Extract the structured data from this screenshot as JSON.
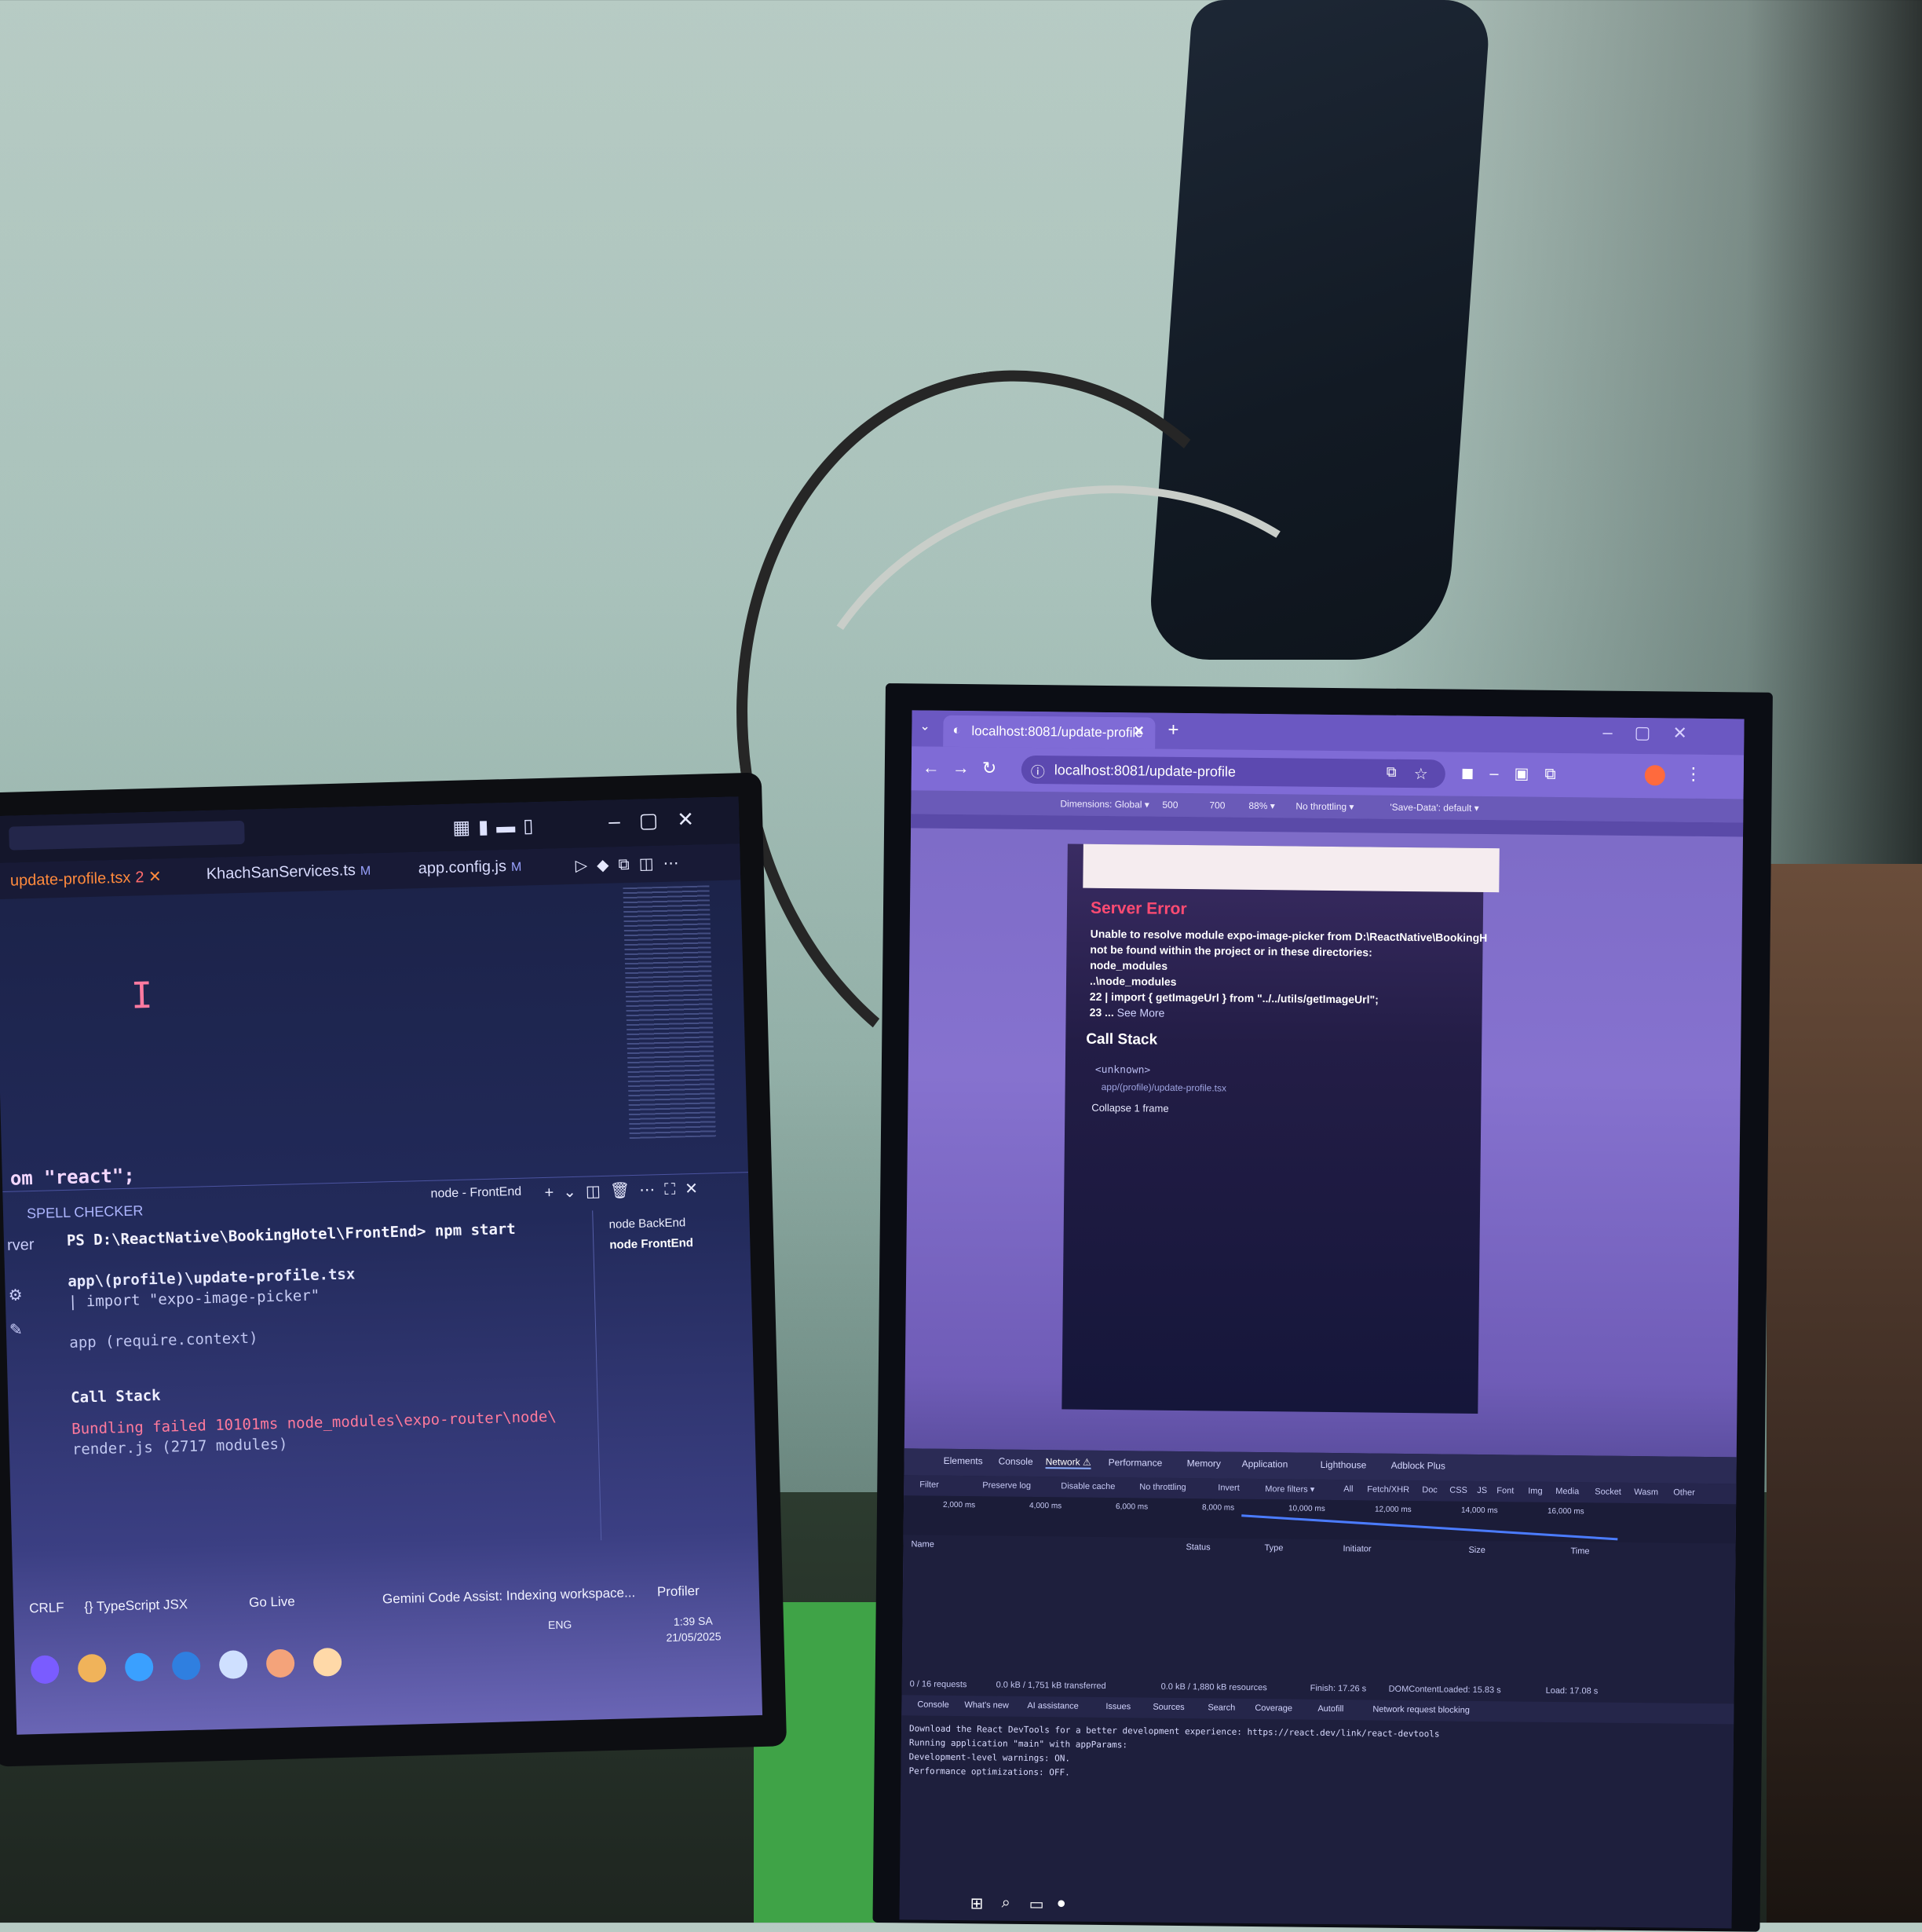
{
  "colors": {
    "vscode_tab_active": "#ff8a3d",
    "error_red": "#ff4b72",
    "chrome_frame": "#7f6bd6"
  },
  "laptop": {
    "tabs": [
      {
        "label": "update-profile.tsx",
        "badge": "2"
      },
      {
        "label": "KhachSanServices.ts",
        "badge": "M"
      },
      {
        "label": "app.config.js",
        "badge": "M"
      }
    ],
    "editor_code": "om \"react\";",
    "panel_label": "SPELL CHECKER",
    "terminal_tab": "node - FrontEnd",
    "sessions": [
      "node BackEnd",
      "node FrontEnd"
    ],
    "terminal": {
      "prompt": "PS D:\\ReactNative\\BookingHotel\\FrontEnd> npm start",
      "path": "app\\(profile)\\update-profile.tsx",
      "import_line": "| import \"expo-image-picker\"",
      "app_line": "app (require.context)",
      "call_stack": "Call Stack",
      "bundling": "Bundling failed 10101ms node_modules\\expo-router\\node\\",
      "render": "render.js (2717 modules)"
    },
    "gutter_label": "rver",
    "status": {
      "crlf": "CRLF",
      "lang": "{} TypeScript JSX",
      "golive": "Go Live",
      "gemini": "Gemini Code Assist: Indexing workspace...",
      "profiler": "Profiler"
    },
    "tray": {
      "lang": "ENG",
      "time": "1:39 SA",
      "date": "21/05/2025"
    }
  },
  "browser": {
    "tab_title": "localhost:8081/update-profile",
    "url": "localhost:8081/update-profile",
    "device_toolbar": {
      "dimensions": "Dimensions: Global ▾",
      "width": "500",
      "height": "700",
      "zoom": "88% ▾",
      "throttle": "No throttling ▾",
      "save_data": "'Save-Data': default ▾"
    },
    "error": {
      "title": "Server Error",
      "lines": [
        "Unable to resolve module expo-image-picker from D:\\ReactNative\\BookingH",
        "not be found within the project or in these directories:",
        "node_modules",
        "..\\node_modules",
        "22 | import { getImageUrl } from \"../../utils/getImageUrl\";",
        "23 ..."
      ],
      "see_more": "See More",
      "call_stack_title": "Call Stack",
      "frame_fn": "<unknown>",
      "frame_file": "app/(profile)/update-profile.tsx",
      "collapse": "Collapse 1 frame"
    },
    "devtools": {
      "tabs": [
        "Elements",
        "Console",
        "Network ⚠",
        "Performance",
        "Memory",
        "Application",
        "Lighthouse",
        "Adblock Plus"
      ],
      "toolbar": [
        "Filter",
        "Preserve log",
        "Disable cache",
        "No throttling",
        "Invert",
        "More filters ▾",
        "All",
        "Fetch/XHR",
        "Doc",
        "CSS",
        "JS",
        "Font",
        "Img",
        "Media",
        "Socket",
        "Wasm",
        "Other"
      ],
      "timeline": [
        "2,000 ms",
        "4,000 ms",
        "6,000 ms",
        "8,000 ms",
        "10,000 ms",
        "12,000 ms",
        "14,000 ms",
        "16,000 ms"
      ],
      "columns": [
        "Name",
        "Status",
        "Type",
        "Initiator",
        "Size",
        "Time"
      ],
      "summary": [
        "0 / 16 requests",
        "0.0 kB / 1,751 kB transferred",
        "0.0 kB / 1,880 kB resources",
        "Finish: 17.26 s",
        "DOMContentLoaded: 15.83 s",
        "Load: 17.08 s"
      ],
      "console_tabs": [
        "Console",
        "What's new",
        "AI assistance",
        "Issues",
        "Sources",
        "Search",
        "Coverage",
        "Autofill",
        "Network request blocking"
      ],
      "console_lines": [
        "Download the React DevTools for a better development experience: https://react.dev/link/react-devtools",
        "Running application \"main\" with appParams:",
        "Development-level warnings: ON.",
        "Performance optimizations: OFF."
      ]
    }
  }
}
